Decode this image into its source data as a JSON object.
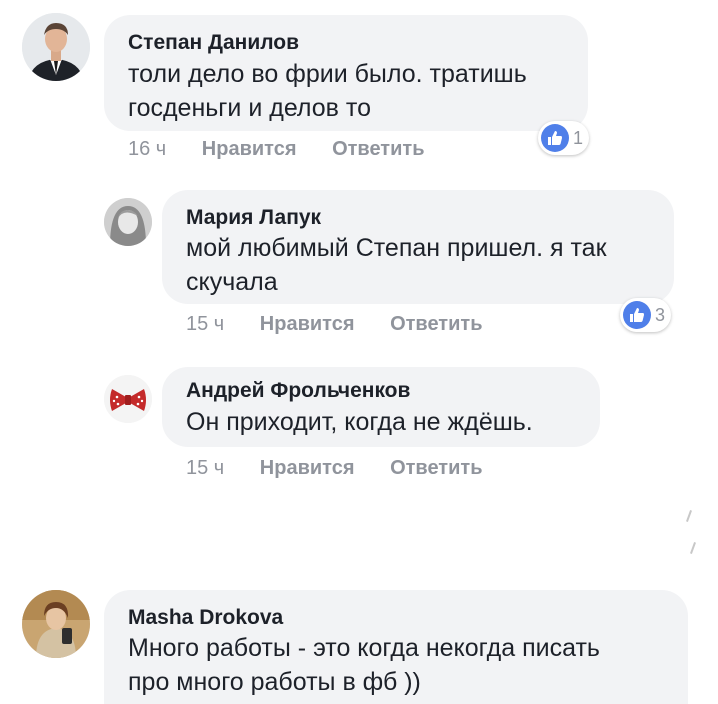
{
  "comments": [
    {
      "author": "Степан Данилов",
      "lines": [
        "толи дело во фрии было. тратишь",
        "госденьги и делов то"
      ],
      "time": "16 ч",
      "like_label": "Нравится",
      "reply_label": "Ответить",
      "reactions": "1",
      "avatar_icon": "man-in-suit-avatar"
    },
    {
      "author": "Мария Лапук",
      "lines": [
        "мой любимый Степан пришел. я так",
        "скучала"
      ],
      "time": "15 ч",
      "like_label": "Нравится",
      "reply_label": "Ответить",
      "reactions": "3",
      "avatar_icon": "woman-portrait-avatar"
    },
    {
      "author": "Андрей Фрольченков",
      "lines": [
        "Он приходит, когда не ждёшь."
      ],
      "time": "15 ч",
      "like_label": "Нравится",
      "reply_label": "Ответить",
      "avatar_icon": "bow-tie-avatar"
    },
    {
      "author": "Masha Drokova",
      "lines": [
        "Много работы - это когда некогда писать",
        "про много работы в фб ))"
      ],
      "avatar_icon": "woman-photo-avatar"
    }
  ],
  "colors": {
    "bubble": "#f2f3f5",
    "text": "#1d2129",
    "meta": "#90949c",
    "like_blue": "#4f7fe9"
  }
}
